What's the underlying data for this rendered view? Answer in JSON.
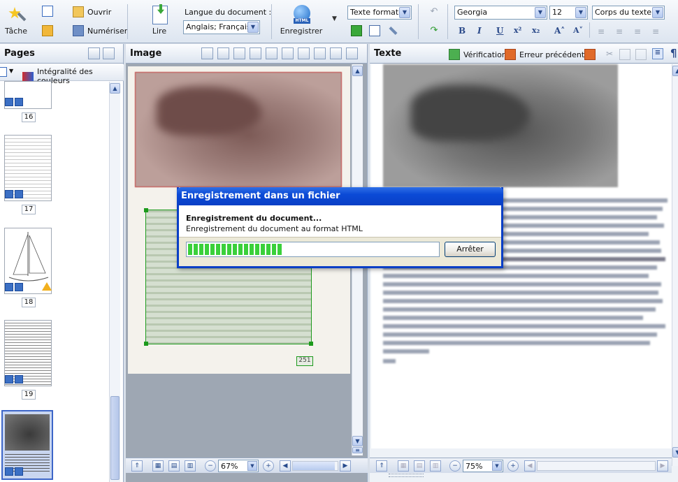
{
  "toolbar": {
    "task_label": "Tâche",
    "open_label": "Ouvrir",
    "scan_label": "Numériser",
    "read_label": "Lire",
    "language_label": "Langue du document :",
    "language_value": "Anglais; Français",
    "save_label": "Enregistrer",
    "format_value": "Texte formaté",
    "font_value": "Georgia",
    "size_value": "12",
    "style_value": "Corps du texte +",
    "format_buttons": [
      "B",
      "I",
      "U",
      "x²",
      "x₂",
      "A˄",
      "A˅"
    ]
  },
  "pages_panel": {
    "title": "Pages",
    "color_mode": "Intégralité des couleurs",
    "page_numbers": [
      "16",
      "17",
      "18",
      "19"
    ]
  },
  "image_panel": {
    "title": "Image",
    "page_label": "251",
    "zoom": "67%"
  },
  "text_panel": {
    "title": "Texte",
    "verify_label": "Vérification",
    "prev_error_label": "Erreur précédente",
    "zoom": "75%"
  },
  "dialog": {
    "title": "Enregistrement dans un fichier",
    "heading": "Enregistrement du document...",
    "subtext": "Enregistrement du document au format HTML",
    "progress": 0.38,
    "stop_label": "Arrêter"
  },
  "colors": {
    "title_bar": "#0a3fc6",
    "progress": "#3ad03a",
    "image_block_border": "#c03838",
    "text_block_border": "#1c9a1c"
  }
}
